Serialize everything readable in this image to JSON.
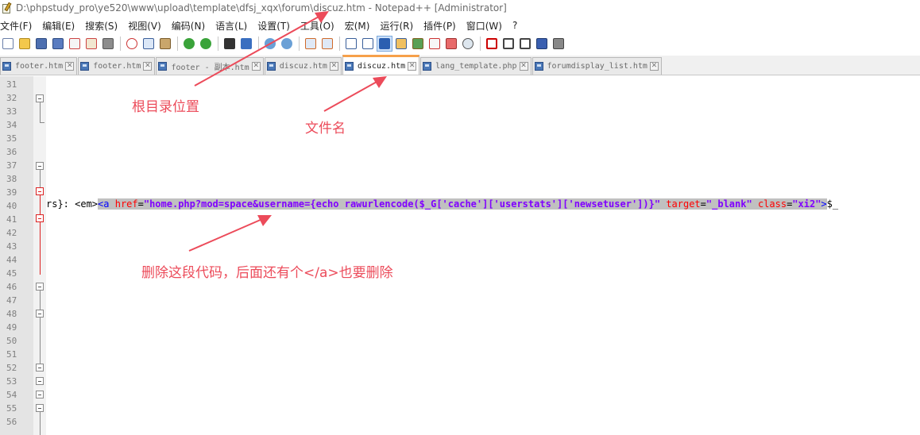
{
  "window": {
    "title": "D:\\phpstudy_pro\\ye520\\www\\upload\\template\\dfsj_xqx\\forum\\discuz.htm - Notepad++ [Administrator]"
  },
  "menu": [
    "文件(F)",
    "编辑(E)",
    "搜索(S)",
    "视图(V)",
    "编码(N)",
    "语言(L)",
    "设置(T)",
    "工具(O)",
    "宏(M)",
    "运行(R)",
    "插件(P)",
    "窗口(W)",
    "?"
  ],
  "toolbar": {
    "icons": [
      "new-file-icon",
      "open-file-icon",
      "save-icon",
      "save-all-icon",
      "close-icon",
      "close-all-icon",
      "print-icon",
      "cut-icon",
      "copy-icon",
      "paste-icon",
      "undo-icon",
      "redo-icon",
      "find-icon",
      "replace-icon",
      "zoom-in-icon",
      "zoom-out-icon",
      "sync-vertical-icon",
      "sync-horizontal-icon",
      "word-wrap-icon",
      "show-all-chars-icon",
      "indent-guide-icon",
      "udl-icon",
      "doc-map-icon",
      "function-list-icon",
      "folder-workspace-icon",
      "monitoring-icon",
      "record-macro-icon",
      "stop-record-icon",
      "play-macro-icon",
      "run-macro-multiple-icon",
      "save-macro-icon"
    ]
  },
  "tabs": [
    {
      "label": "footer.htm",
      "active": false
    },
    {
      "label": "footer.htm",
      "active": false
    },
    {
      "label": "footer - 副本.htm",
      "active": false
    },
    {
      "label": "discuz.htm",
      "active": false
    },
    {
      "label": "discuz.htm",
      "active": true
    },
    {
      "label": "lang_template.php",
      "active": false
    },
    {
      "label": "forumdisplay_list.htm",
      "active": false
    }
  ],
  "line_numbers": [
    "31",
    "32",
    "33",
    "34",
    "35",
    "36",
    "37",
    "38",
    "39",
    "40",
    "41",
    "42",
    "43",
    "44",
    "45",
    "46",
    "47",
    "48",
    "49",
    "50",
    "51",
    "52",
    "53",
    "54",
    "55",
    "56"
  ],
  "code_line_40": {
    "prefix": "rs}: <em>",
    "tag_open": "<a ",
    "attr1": "href",
    "eq1": "=",
    "val1": "\"home.php?mod=space&username={echo rawurlencode($_G['cache']['userstats']['newsetuser'])}\"",
    "sp1": " ",
    "attr2": "target",
    "eq2": "=",
    "val2": "\"_blank\"",
    "sp2": " ",
    "attr3": "class",
    "eq3": "=",
    "val3": "\"xi2\"",
    "tag_close": ">",
    "tail": "$_"
  },
  "annotations": {
    "root_dir": "根目录位置",
    "file_name": "文件名",
    "delete_code": "删除这段代码，后面还有个</a>也要删除"
  },
  "colors": {
    "annotation": "#ec4b5a",
    "active_tab_accent": "#f6a04a",
    "selection": "#c0c0c0"
  }
}
